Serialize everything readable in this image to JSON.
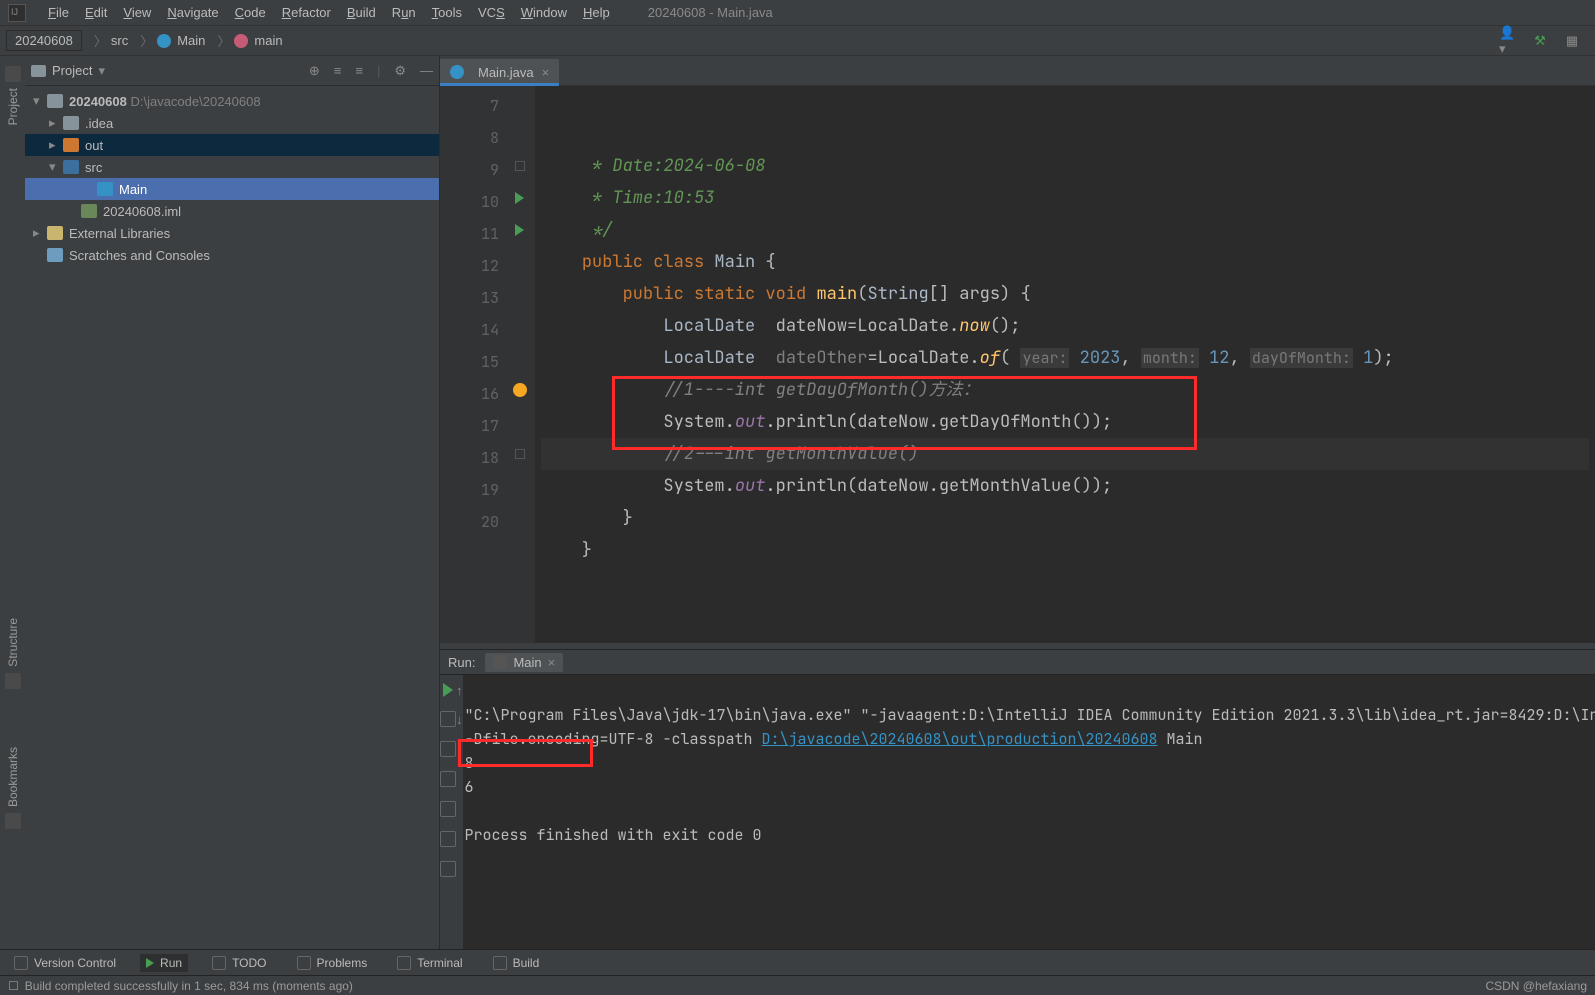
{
  "menu": [
    "File",
    "Edit",
    "View",
    "Navigate",
    "Code",
    "Refactor",
    "Build",
    "Run",
    "Tools",
    "VCS",
    "Window",
    "Help"
  ],
  "window_title": "20240608 - Main.java",
  "breadcrumb": {
    "project": "20240608",
    "folder": "src",
    "class": "Main",
    "method": "main"
  },
  "project_pane": {
    "title": "Project",
    "root": {
      "name": "20240608",
      "path": "D:\\javacode\\20240608"
    },
    "nodes": {
      "idea": ".idea",
      "out": "out",
      "src": "src",
      "main": "Main",
      "iml": "20240608.iml",
      "ext": "External Libraries",
      "scratch": "Scratches and Consoles"
    }
  },
  "tab": {
    "name": "Main.java"
  },
  "editor": {
    "first_line_no": 7,
    "lines": [
      {
        "n": 7,
        "html": "     <span class='c-doc'>* Date:2024-06-08</span>"
      },
      {
        "n": 8,
        "html": "     <span class='c-doc'>* Time:10:53</span>"
      },
      {
        "n": 9,
        "html": "     <span class='c-doc'>*/</span>",
        "icon": "fold"
      },
      {
        "n": 10,
        "html": "    <span class='c-key'>public class</span> <span class='c-id'>Main</span> {",
        "icon": "run"
      },
      {
        "n": 11,
        "html": "        <span class='c-key'>public static</span> <span class='c-key'>void</span> <span class='c-methC'>main</span>(<span class='c-id'>String</span>[] args) {",
        "icon": "run",
        "fold": true
      },
      {
        "n": 12,
        "html": "            <span class='c-id'>LocalDate</span>  dateNow=LocalDate.<span class='c-meth'>now</span>();"
      },
      {
        "n": 13,
        "html": "            <span class='c-id'>LocalDate</span>  <span class='faded'>dateOther</span>=LocalDate.<span class='c-meth'>of</span>( <span class='c-hint'>year:</span> <span class='c-num'>2023</span>, <span class='c-hint'>month:</span> <span class='c-num'>12</span>, <span class='c-hint'>dayOfMonth:</span> <span class='c-num'>1</span>);"
      },
      {
        "n": 14,
        "html": "            <span class='c-comment'>//1----int getDayOfMonth()方法：</span>"
      },
      {
        "n": 15,
        "html": "            System.<span class='c-field'>out</span>.println(dateNow.getDayOfMonth());"
      },
      {
        "n": 16,
        "html": "            <span class='c-comment'>//2---int getMonthValue()</span>",
        "cursor": true,
        "bulb": true
      },
      {
        "n": 17,
        "html": "            System.<span class='c-field'>out</span>.println(dateNow.getMonthValue());"
      },
      {
        "n": 18,
        "html": "        }",
        "fold": true
      },
      {
        "n": 19,
        "html": "    }"
      },
      {
        "n": 20,
        "html": ""
      }
    ]
  },
  "run": {
    "label": "Run:",
    "tab": "Main",
    "cmd_a": "\"C:\\Program Files\\Java\\jdk-17\\bin\\java.exe\" \"-javaagent:D:\\IntelliJ IDEA Community Edition 2021.3.3\\lib\\idea_rt.jar=8429:D:\\IntelliJ IDEA Community",
    "cmd_b": "-Dfile.encoding=UTF-8 -classpath ",
    "cmd_link": "D:\\javacode\\20240608\\out\\production\\20240608",
    "cmd_c": " Main",
    "out1": "8",
    "out2": "6",
    "exit": "Process finished with exit code 0"
  },
  "bottom": {
    "vcs": "Version Control",
    "run": "Run",
    "todo": "TODO",
    "problems": "Problems",
    "terminal": "Terminal",
    "build": "Build"
  },
  "status": {
    "left": "Build completed successfully in 1 sec, 834 ms (moments ago)",
    "right": "CSDN @hefaxiang"
  },
  "side_labels": {
    "project": "Project",
    "structure": "Structure",
    "bookmarks": "Bookmarks"
  }
}
